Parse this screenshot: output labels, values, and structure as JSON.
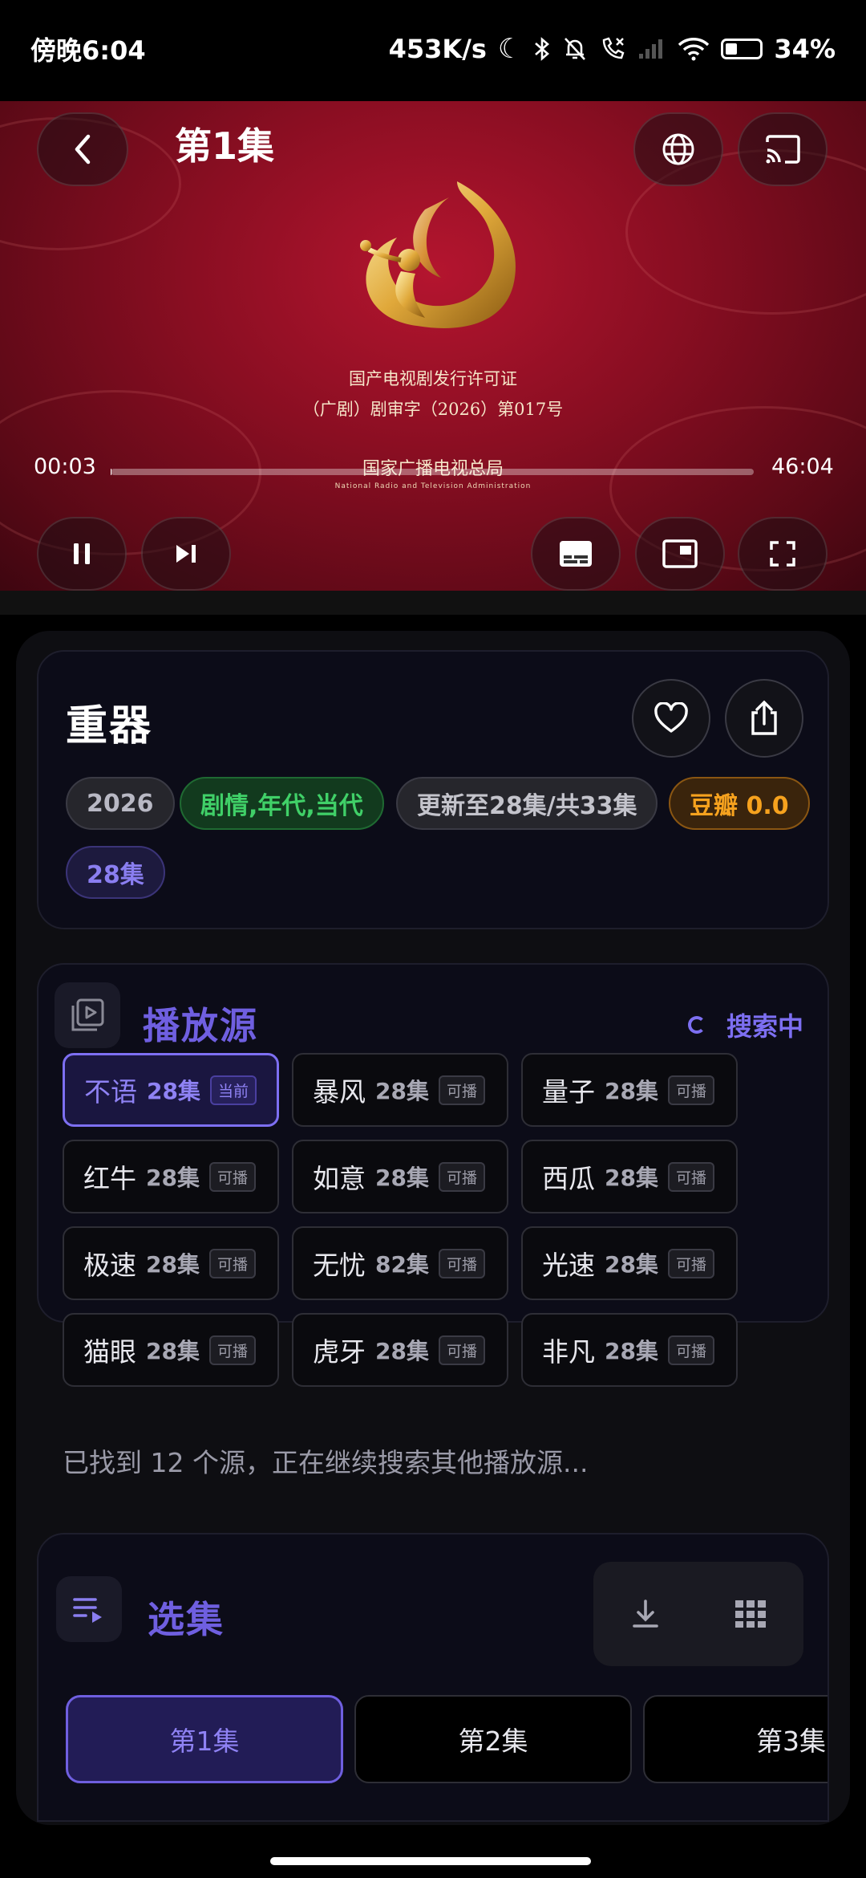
{
  "status_bar": {
    "time": "傍晚6:04",
    "net_speed": "453K/s",
    "battery": "34%",
    "battery_level": 0.34
  },
  "player": {
    "episode_title": "第1集",
    "current_time": "00:03",
    "total_time": "46:04",
    "progress_fraction": 0.001,
    "certificate_line1": "国产电视剧发行许可证",
    "certificate_line2": "（广剧）剧审字（2026）第017号",
    "agency_cn": "国家广播电视总局",
    "agency_en": "National Radio and Television Administration"
  },
  "show": {
    "title": "重器",
    "year": "2026",
    "genres": "剧情,年代,当代",
    "update_status": "更新至28集/共33集",
    "douban": "豆瓣 0.0",
    "episode_count": "28集"
  },
  "sources_section": {
    "title": "播放源",
    "status": "搜索中",
    "sources": [
      {
        "name": "不语",
        "count": "28集",
        "badge": "当前",
        "active": true
      },
      {
        "name": "暴风",
        "count": "28集",
        "badge": "可播"
      },
      {
        "name": "量子",
        "count": "28集",
        "badge": "可播"
      },
      {
        "name": "红牛",
        "count": "28集",
        "badge": "可播"
      },
      {
        "name": "如意",
        "count": "28集",
        "badge": "可播"
      },
      {
        "name": "西瓜",
        "count": "28集",
        "badge": "可播"
      },
      {
        "name": "极速",
        "count": "28集",
        "badge": "可播"
      },
      {
        "name": "无忧",
        "count": "82集",
        "badge": "可播"
      },
      {
        "name": "光速",
        "count": "28集",
        "badge": "可播"
      },
      {
        "name": "猫眼",
        "count": "28集",
        "badge": "可播"
      },
      {
        "name": "虎牙",
        "count": "28集",
        "badge": "可播"
      },
      {
        "name": "非凡",
        "count": "28集",
        "badge": "可播"
      }
    ],
    "found_text": "已找到 12 个源，正在继续搜索其他播放源..."
  },
  "episodes_section": {
    "title": "选集",
    "episodes": [
      "第1集",
      "第2集",
      "第3集"
    ]
  },
  "colors": {
    "accent": "#6f5fe0",
    "genre_green": "#40d068",
    "douban_orange": "#f6a21e"
  }
}
